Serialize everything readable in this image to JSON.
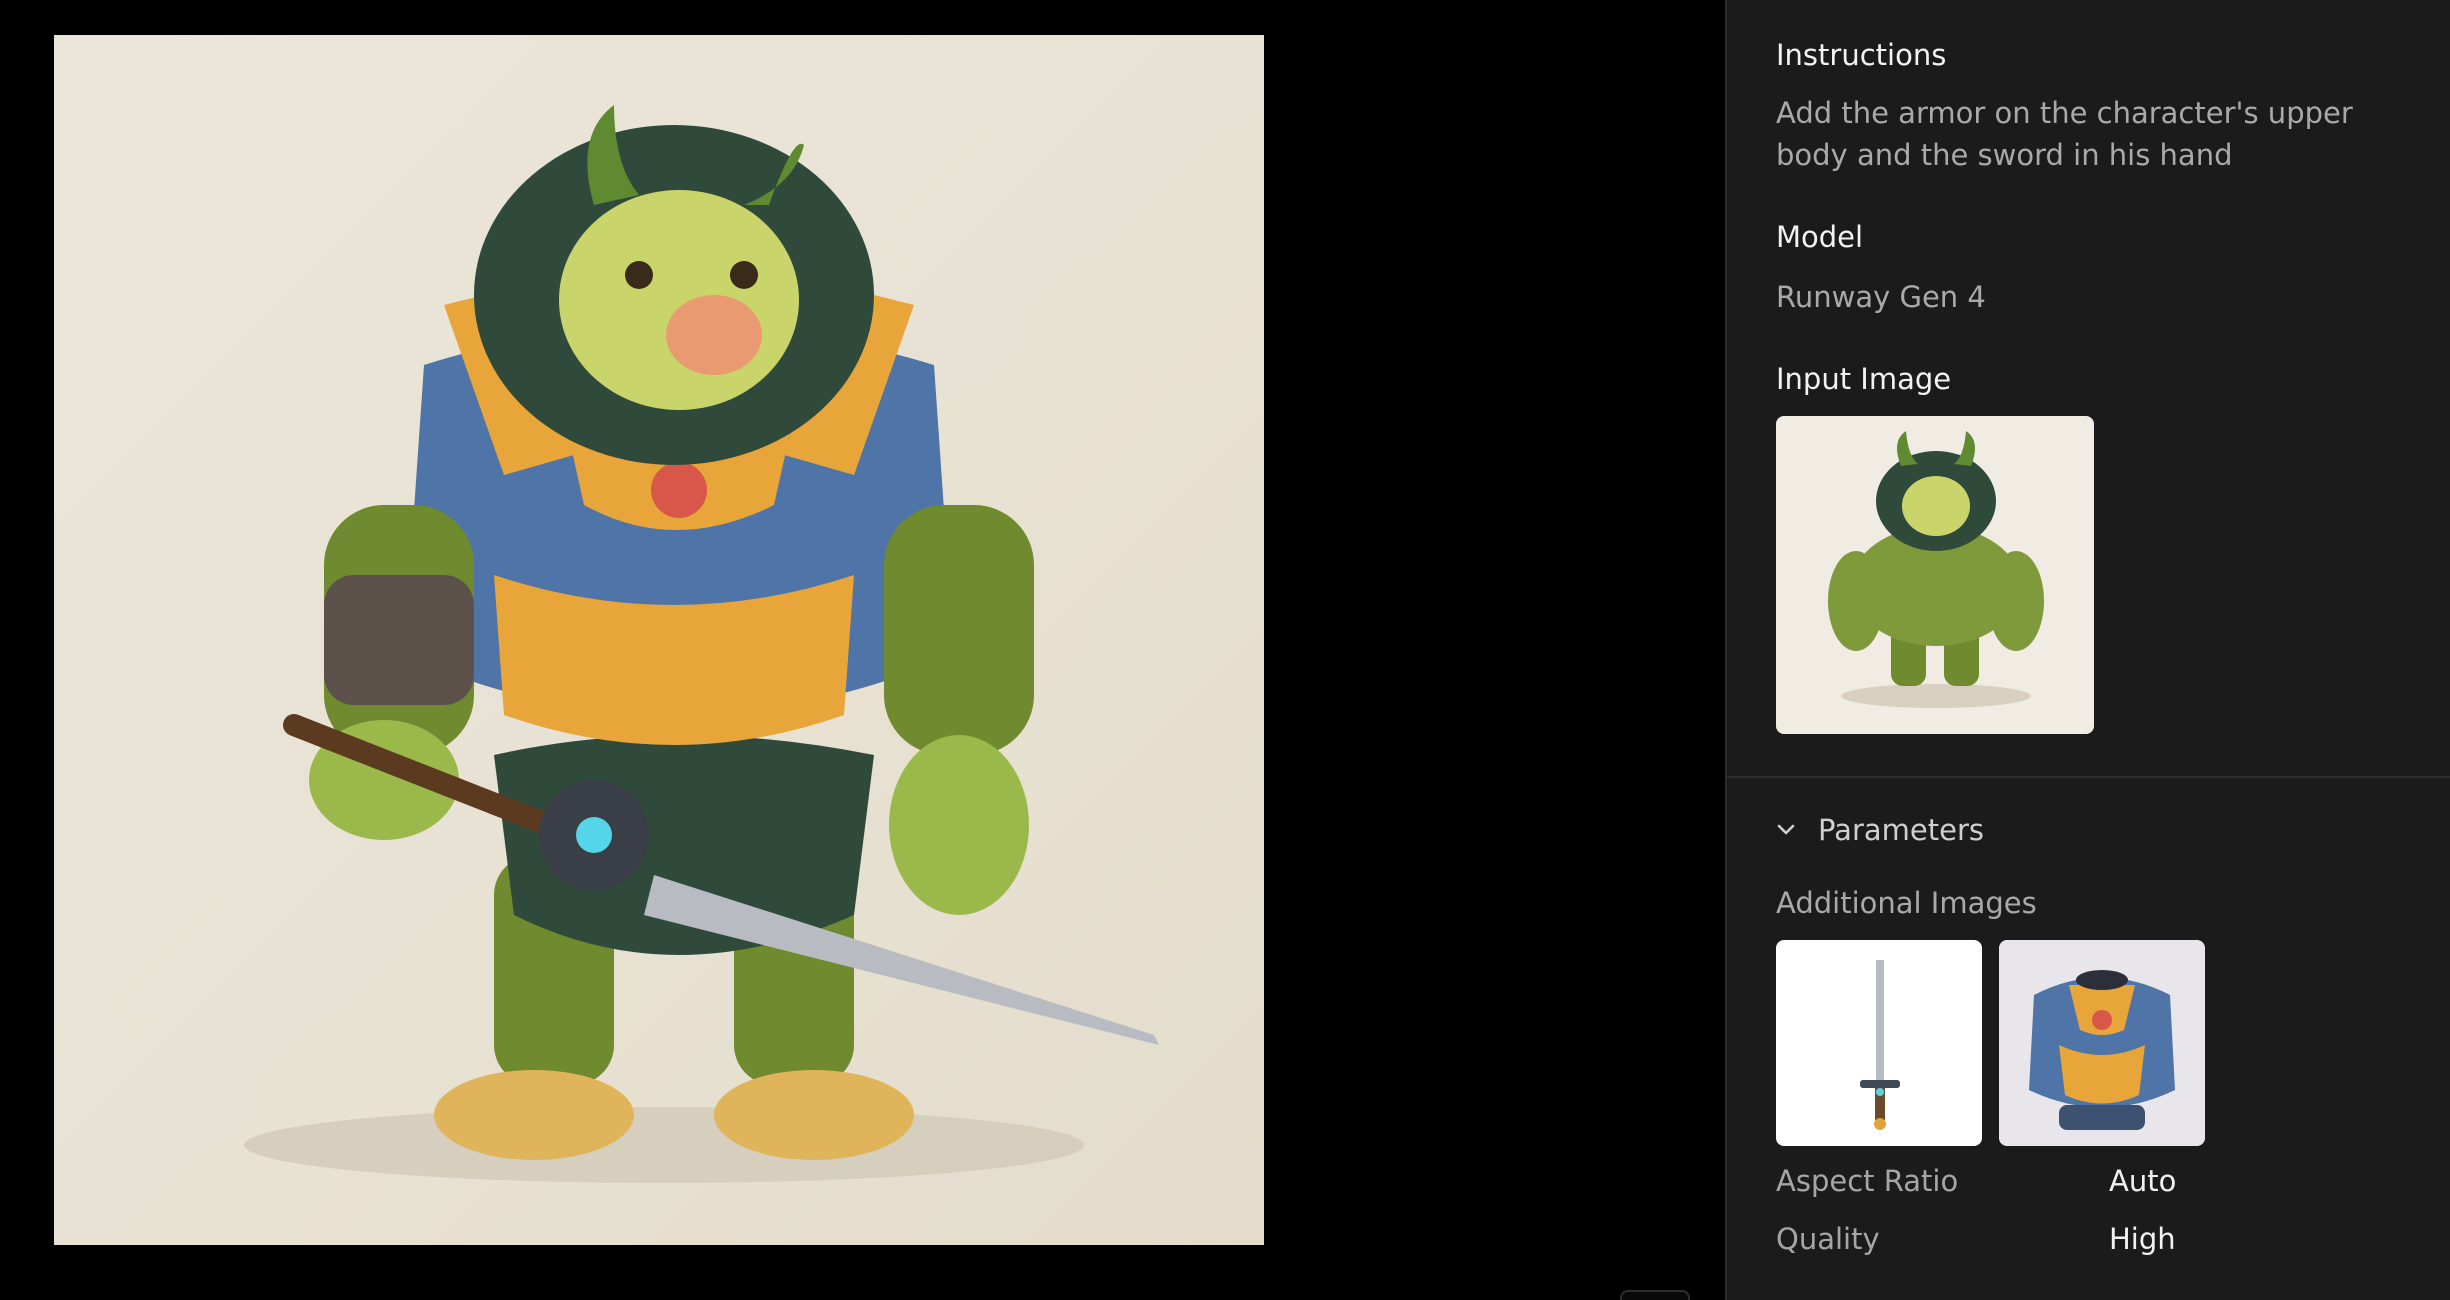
{
  "instructions": {
    "label": "Instructions",
    "text": "Add the armor on the character's upper body and the sword in his hand"
  },
  "model": {
    "label": "Model",
    "value": "Runway Gen 4"
  },
  "input_image": {
    "label": "Input Image"
  },
  "parameters": {
    "toggle_label": "Parameters",
    "additional_images_label": "Additional Images",
    "rows": [
      {
        "key": "Aspect Ratio",
        "value": "Auto"
      },
      {
        "key": "Quality",
        "value": "High"
      }
    ]
  },
  "icons": {
    "parameters_toggle": "chevron-down-icon"
  },
  "colors": {
    "panel_bg": "#1b1b1b",
    "viewer_bg": "#000000",
    "label": "#f2f2f2",
    "muted": "#a9a9a9"
  }
}
